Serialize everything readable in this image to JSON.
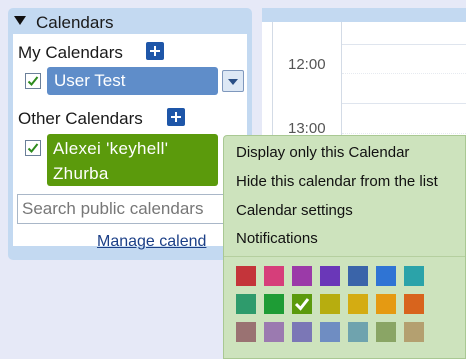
{
  "panel": {
    "header": "Calendars",
    "my_calendars_title": "My Calendars",
    "my_calendar": {
      "name": "User Test",
      "checked": true,
      "color": "#5f8dc9"
    },
    "other_calendars_title": "Other Calendars",
    "other_calendar": {
      "name_line1": "Alexei 'keyhell'",
      "name_line2": "Zhurba",
      "checked": true,
      "color": "#5b9a0c"
    },
    "search_placeholder": "Search public calendars",
    "manage_link": "Manage calend"
  },
  "day_grid": {
    "time_labels": [
      "12:00",
      "13:00"
    ]
  },
  "context_menu": {
    "items": [
      "Display only this Calendar",
      "Hide this calendar from the list",
      "Calendar settings",
      "Notifications"
    ],
    "selected_color": "#5b9a0c",
    "palette": [
      [
        "#c4343a",
        "#d63e7a",
        "#9b3aa8",
        "#6a37b8",
        "#3a64a9",
        "#2f74d4",
        "#2ba3a9"
      ],
      [
        "#2e9b6c",
        "#1e9c35",
        "#5b9a0c",
        "#b7ad0f",
        "#d4ac12",
        "#e59a12",
        "#d8641d"
      ],
      [
        "#9a7272",
        "#9b7ab0",
        "#7b77b6",
        "#6f8dc2",
        "#6fa3ae",
        "#8aa565",
        "#b4a070"
      ]
    ]
  }
}
